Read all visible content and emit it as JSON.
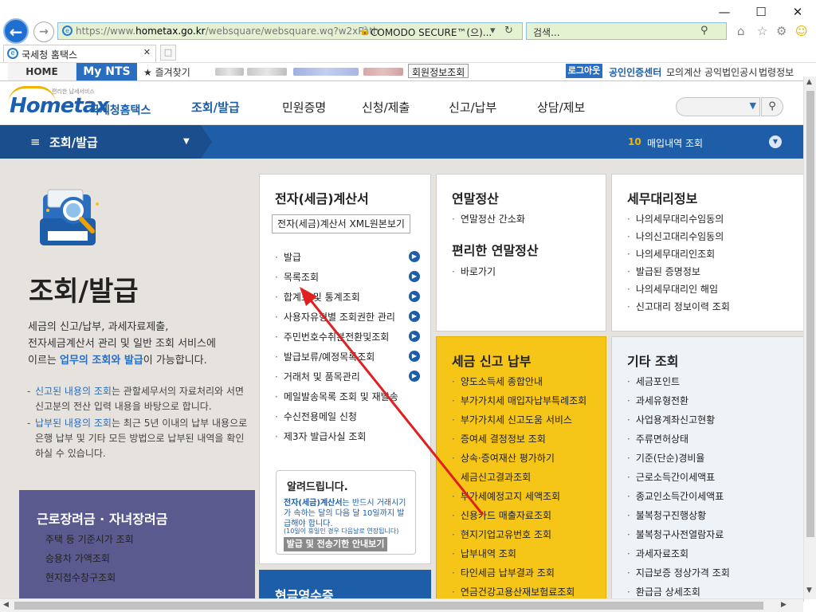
{
  "browser": {
    "window_controls": {
      "minimize": "—",
      "maximize": "☐",
      "close": "✕"
    },
    "address": {
      "url_prefix": "https://www.",
      "url_domain": "hometax.go.kr",
      "url_path": "/websquare/websquare.wq?w2xPath",
      "certificate": "COMODO SECURE™(으)...",
      "search_placeholder": "검색..."
    },
    "tab": {
      "title": "국세청 홈택스",
      "new_tab_icon": "new-tab-icon"
    },
    "favorites": {
      "home": "HOME",
      "mynts": "My NTS",
      "favorites_label": "★ 즐겨찾기"
    },
    "member_info_button": "회원정보조회",
    "logout": "로그아웃",
    "top_links": [
      "공인인증센터",
      "모의계산",
      "공익법인공시",
      "법령정보"
    ]
  },
  "site": {
    "logo": {
      "brand": "Hometax",
      "name": "국세청홈택스",
      "tagline": "편리한 납세서비스"
    },
    "gnb": [
      "조회/발급",
      "민원증명",
      "신청/제출",
      "신고/납부",
      "상담/제보"
    ],
    "current_menu": "조회/발급",
    "recent": {
      "count": "10",
      "label": "매입내역 조회"
    }
  },
  "left": {
    "title": "조회/발급",
    "description": [
      "세금의 신고/납부, 과세자료제출,",
      "전자세금계산서 관리 및 일반 조회 서비스에",
      "이르는 ",
      "업무의 조회와 발급",
      "이 가능합니다."
    ],
    "notes": [
      {
        "bold": "신고된 내용의 조회",
        "text": "는 관할세무서의 자료처리와 서면신고분의 전산 입력 내용을 바탕으로 합니다."
      },
      {
        "bold": "납부된 내용의 조회",
        "text": "는 최근 5년 이내의 납부 내용으로 은행 납부 및 기타 모든 방법으로 납부된 내역을 확인하실 수 있습니다."
      }
    ],
    "promo": {
      "title": "근로장려금 · 자녀장려금",
      "items": [
        "주택 등 기준시가 조회",
        "승용차 가액조회",
        "현지접수창구조회"
      ]
    }
  },
  "panels": {
    "einvoice": {
      "title": "전자(세금)계산서",
      "xml_button": "전자(세금)계산서 XML원본보기",
      "items": [
        "발급",
        "목록조회",
        "합계표 및 통계조회",
        "사용자유형별 조회권한 관리",
        "주민번호수취분전환및조회",
        "발급보류/예정목록조회",
        "거래처 및 품목관리",
        "메일발송목록 조회 및 재발송",
        "수신전용메일 신청",
        "제3자 발급사실 조회"
      ],
      "notice": {
        "title": "알려드립니다.",
        "text_bold": "전자(세금)계산서",
        "text": "는 반드시 거래시기가 속하는 달의 다음 달 10일까지 발급해야 합니다.",
        "small": "(10일이 휴일인 경우 다음날로 연장됩니다)",
        "button": "발급 및 전송기한 안내보기"
      }
    },
    "yearend": {
      "title": "연말정산",
      "items": [
        "연말정산 간소화"
      ],
      "title2": "편리한 연말정산",
      "items2": [
        "바로가기"
      ]
    },
    "agent": {
      "title": "세무대리정보",
      "items": [
        "나의세무대리수임동의",
        "나의신고대리수임동의",
        "나의세무대리인조회",
        "발급된 증명정보",
        "나의세무대리인 해임",
        "신고대리 정보이력 조회"
      ]
    },
    "taxpay": {
      "title": "세금 신고 납부",
      "items": [
        "양도소득세 종합안내",
        "부가가치세 매입자납부특례조회",
        "부가가치세 신고도움 서비스",
        "증여세 결정정보 조회",
        "상속·증여재산 평가하기",
        "세금신고결과조회",
        "부가세예정고지 세액조회",
        "신용카드 매출자료조회",
        "현지기업고유번호 조회",
        "납부내역 조회",
        "타인세금 납부결과 조회",
        "연금건강고용산재보험료조회"
      ]
    },
    "etc": {
      "title": "기타 조회",
      "items": [
        "세금포인트",
        "과세유형전환",
        "사업용계좌신고현황",
        "주류면허상태",
        "기준(단순)경비율",
        "근로소득간이세액표",
        "종교인소득간이세액표",
        "불복청구진행상황",
        "불복청구사전열람자료",
        "과세자료조회",
        "지급보증 정상가격 조회",
        "환급금 상세조회"
      ]
    },
    "cash": {
      "title": "현금영수증"
    }
  },
  "colors": {
    "brand_blue": "#1e5ea8",
    "tax_yellow": "#f5c518",
    "annotation_red": "#e02020"
  }
}
